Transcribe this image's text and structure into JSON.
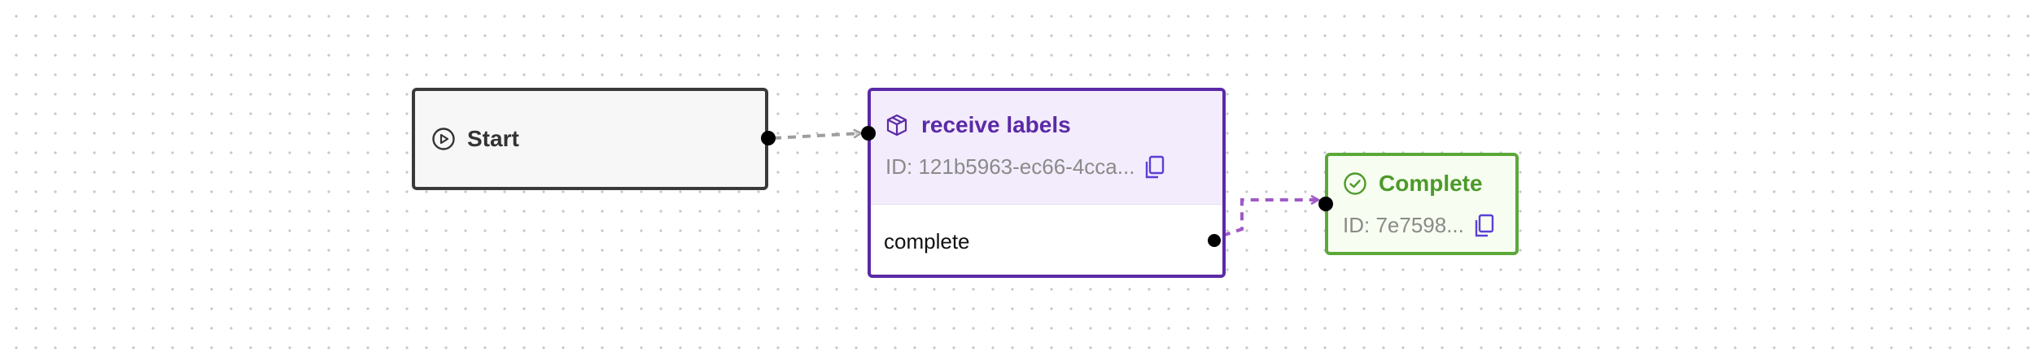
{
  "nodes": {
    "start": {
      "label": "Start",
      "icon": "play-circle-icon"
    },
    "action": {
      "label": "receive labels",
      "icon": "package-icon",
      "id_text": "ID: 121b5963-ec66-4cca...",
      "copy_icon": "copy-icon",
      "output_port_label": "complete"
    },
    "complete": {
      "label": "Complete",
      "icon": "check-circle-icon",
      "id_text": "ID: 7e7598...",
      "copy_icon": "copy-icon"
    }
  },
  "edges": [
    {
      "from": "start",
      "to": "receive labels",
      "style": "dashed",
      "color": "#9e9e9e"
    },
    {
      "from": "receive labels.complete",
      "to": "Complete",
      "style": "dashed",
      "color": "#a05ac4"
    }
  ],
  "colors": {
    "start_border": "#3a3a3a",
    "action_border": "#5b2aa6",
    "action_header_bg": "#f3ecfc",
    "complete_border": "#5ba83a",
    "complete_title": "#4c9a2a",
    "copy_icon": "#5b3fd6"
  }
}
